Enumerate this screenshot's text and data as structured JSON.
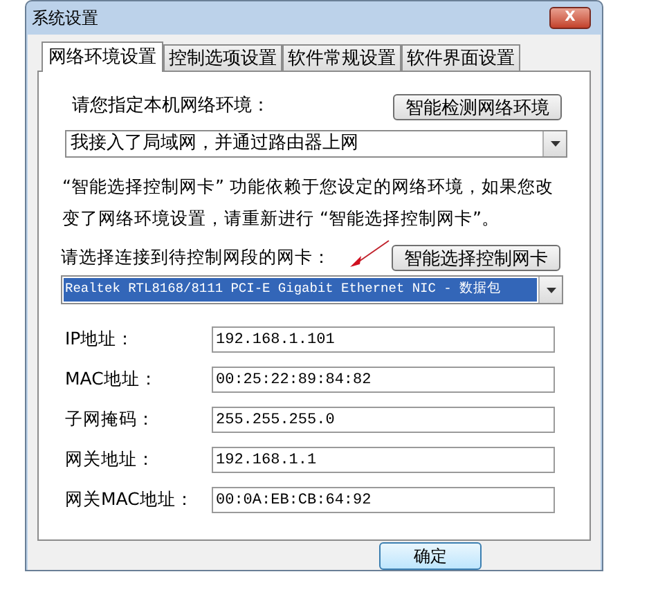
{
  "window": {
    "title": "系统设置",
    "close": "X"
  },
  "tabs": [
    {
      "label": "网络环境设置",
      "selected": true
    },
    {
      "label": "控制选项设置",
      "selected": false
    },
    {
      "label": "软件常规设置",
      "selected": false
    },
    {
      "label": "软件界面设置",
      "selected": false
    }
  ],
  "network": {
    "label": "请您指定本机网络环境：",
    "detect_button": "智能检测网络环境",
    "value": "我接入了局域网，并通过路由器上网"
  },
  "note": "“智能选择控制网卡” 功能依赖于您设定的网络环境，如果您改变了网络环境设置，请重新进行 “智能选择控制网卡”。",
  "nic": {
    "label": "请选择连接到待控制网段的网卡：",
    "select_button": "智能选择控制网卡",
    "value": "Realtek RTL8168/8111 PCI-E Gigabit Ethernet NIC - 数据包"
  },
  "fields": [
    {
      "label": "IP地址：",
      "value": "192.168.1.101"
    },
    {
      "label": "MAC地址：",
      "value": "00:25:22:89:84:82"
    },
    {
      "label": "子网掩码：",
      "value": "255.255.255.0"
    },
    {
      "label": "网关地址：",
      "value": "192.168.1.1"
    },
    {
      "label": "网关MAC地址：",
      "value": "00:0A:EB:CB:64:92"
    }
  ],
  "buttons": [
    "确定"
  ]
}
